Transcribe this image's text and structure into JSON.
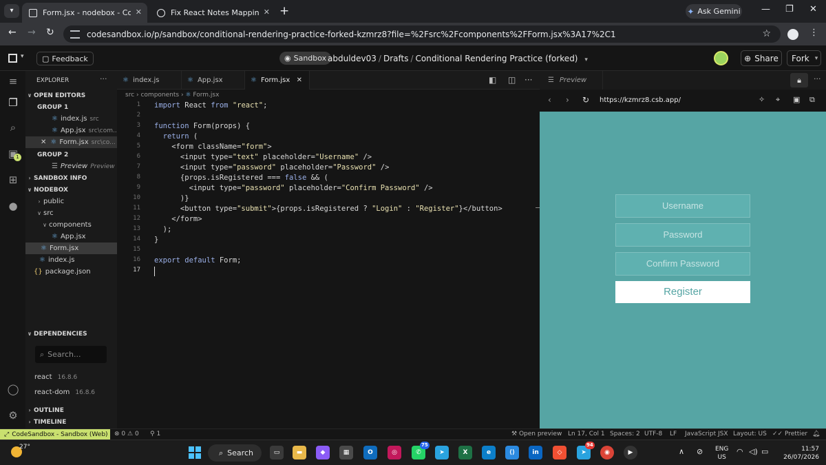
{
  "browser": {
    "tabs": [
      {
        "title": "Form.jsx - nodebox - CodeSandbox",
        "active": true
      },
      {
        "title": "Fix React Notes Mapping",
        "active": false
      }
    ],
    "ask_gemini": "Ask Gemini",
    "url": "codesandbox.io/p/sandbox/conditional-rendering-practice-forked-kzmrz8?file=%2Fsrc%2Fcomponents%2FForm.jsx%3A17%2C1"
  },
  "csb_header": {
    "feedback": "Feedback",
    "sandbox_label": "Sandbox",
    "breadcrumb": [
      "abduldev03",
      "Drafts",
      "Conditional Rendering Practice (forked)"
    ],
    "share": "Share",
    "fork": "Fork"
  },
  "explorer": {
    "title": "EXPLORER",
    "open_editors": "OPEN EDITORS",
    "group1": "GROUP 1",
    "group1_items": [
      {
        "name": "index.js",
        "meta": "src"
      },
      {
        "name": "App.jsx",
        "meta": "src\\com..."
      },
      {
        "name": "Form.jsx",
        "meta": "src\\co..."
      }
    ],
    "group2": "GROUP 2",
    "group2_items": [
      {
        "name": "Preview",
        "meta": "Preview"
      }
    ],
    "sandbox_info": "SANDBOX INFO",
    "nodebox": "NODEBOX",
    "tree": [
      "public",
      "src",
      "components",
      "App.jsx",
      "Form.jsx",
      "index.js",
      "package.json"
    ],
    "dependencies": "DEPENDENCIES",
    "dep_search_placeholder": "Search...",
    "deps": [
      {
        "name": "react",
        "version": "16.8.6"
      },
      {
        "name": "react-dom",
        "version": "16.8.6"
      }
    ],
    "outline": "OUTLINE",
    "timeline": "TIMELINE"
  },
  "editor": {
    "tabs": [
      "index.js",
      "App.jsx",
      "Form.jsx"
    ],
    "breadcrumb": [
      "src",
      "components",
      "Form.jsx"
    ],
    "line_numbers": [
      "1",
      "2",
      "3",
      "4",
      "5",
      "6",
      "7",
      "8",
      "9",
      "10",
      "11",
      "12",
      "13",
      "14",
      "15",
      "16",
      "17"
    ],
    "lines": [
      "import React from \"react\";",
      "",
      "function Form(props) {",
      "  return (",
      "    <form className=\"form\">",
      "      <input type=\"text\" placeholder=\"Username\" />",
      "      <input type=\"password\" placeholder=\"Password\" />",
      "      {props.isRegistered === false && (",
      "        <input type=\"password\" placeholder=\"Confirm Password\" />",
      "      )}",
      "      <button type=\"submit\">{props.isRegistered ? \"Login\" : \"Register\"}</button>",
      "    </form>",
      "  );",
      "}",
      "",
      "export default Form;",
      ""
    ]
  },
  "preview": {
    "tab": "Preview",
    "url": "https://kzmrz8.csb.app/",
    "username_placeholder": "Username",
    "password_placeholder": "Password",
    "confirm_placeholder": "Confirm Password",
    "button": "Register",
    "bg_color": "#56a5a4"
  },
  "status": {
    "remote": "CodeSandbox - Sandbox (Web)",
    "errors": "0",
    "warnings": "0",
    "ports": "1",
    "open_preview": "Open preview",
    "position": "Ln 17, Col 1",
    "spaces": "Spaces: 2",
    "encoding": "UTF-8",
    "eol": "LF",
    "language": "JavaScript JSX",
    "layout": "Layout: US",
    "prettier": "Prettier"
  },
  "taskbar": {
    "temp": "27°",
    "search": "Search",
    "whatsapp_badge": "75",
    "app_badge": "94",
    "lang1": "ENG",
    "lang2": "US",
    "time": "11:57",
    "date": "26/07/2026"
  }
}
